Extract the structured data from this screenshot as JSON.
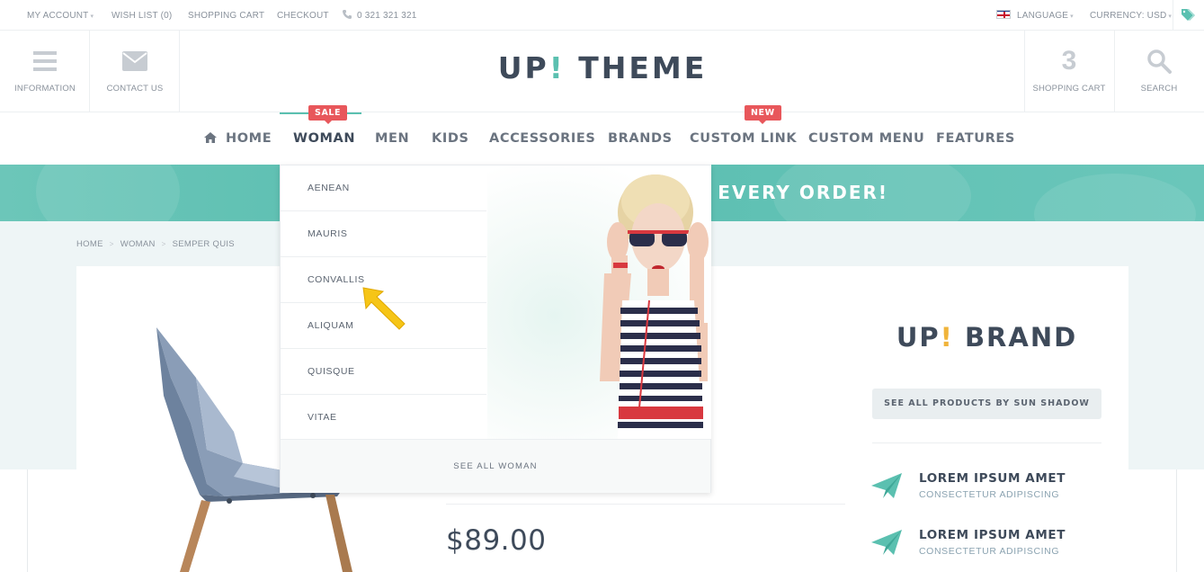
{
  "topbar": {
    "my_account": "MY ACCOUNT",
    "wish_list": "WISH LIST (0)",
    "shopping_cart": "SHOPPING CART",
    "checkout": "CHECKOUT",
    "phone": "0 321 321 321",
    "language": "LANGUAGE",
    "currency": "CURRENCY: USD"
  },
  "header": {
    "information": "INFORMATION",
    "contact_us": "CONTACT US",
    "logo_main": "UP",
    "logo_excl": "!",
    "logo_rest": " THEME",
    "cart_count": "3",
    "shopping_cart": "SHOPPING CART",
    "search": "SEARCH"
  },
  "nav": {
    "items": [
      "HOME",
      "WOMAN",
      "MEN",
      "KIDS",
      "ACCESSORIES",
      "BRANDS",
      "CUSTOM LINK",
      "CUSTOM MENU",
      "FEATURES"
    ],
    "active": "WOMAN",
    "badges": {
      "sale": "SALE",
      "new": "NEW"
    }
  },
  "banner": {
    "text": "TH EVERY ORDER!"
  },
  "breadcrumb": [
    "HOME",
    "WOMAN",
    "SEMPER QUIS"
  ],
  "dropdown": {
    "items": [
      "AENEAN",
      "MAURIS",
      "CONVALLIS",
      "ALIQUAM",
      "QUISQUE",
      "VITAE"
    ],
    "see_all": "SEE ALL WOMAN"
  },
  "product": {
    "price": "$89.00"
  },
  "sidebar": {
    "brand_main": "UP",
    "brand_excl": "!",
    "brand_rest": " BRAND",
    "see_all": "SEE ALL PRODUCTS BY SUN SHADOW",
    "features": [
      {
        "title": "LOREM IPSUM AMET",
        "subtitle": "CONSECTETUR ADIPISCING"
      },
      {
        "title": "LOREM IPSUM AMET",
        "subtitle": "CONSECTETUR ADIPISCING"
      }
    ]
  },
  "colors": {
    "accent": "#5bc0b0",
    "sale": "#e8575b",
    "text_dark": "#3e4a5a",
    "brand_excl": "#f0b43b"
  },
  "icons": [
    "phone-icon",
    "flag-uk-icon",
    "tag-icon",
    "menu-icon",
    "mail-icon",
    "search-icon",
    "home-icon",
    "paper-plane-icon",
    "arrow-pointer-icon"
  ]
}
